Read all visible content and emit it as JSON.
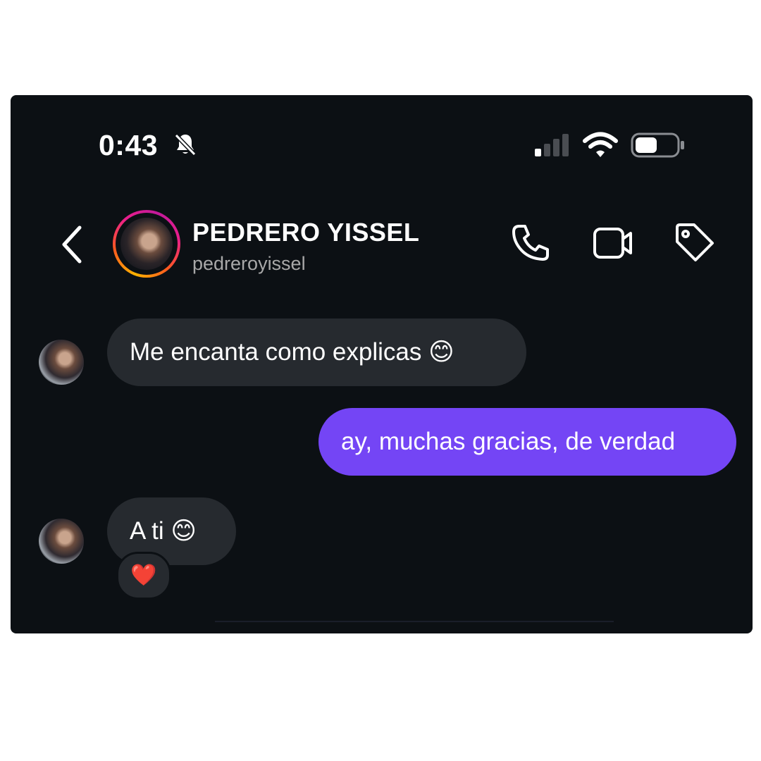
{
  "status_bar": {
    "time": "0:43",
    "mute_icon": "bell-slash-icon",
    "signal_icon": "cellular-signal-icon",
    "wifi_icon": "wifi-icon",
    "battery_icon": "battery-icon"
  },
  "header": {
    "back_icon": "chevron-left-icon",
    "name": "PEDRERO YISSEL",
    "username": "pedreroyissel",
    "actions": [
      "phone-icon",
      "video-camera-icon",
      "tag-icon"
    ]
  },
  "messages": [
    {
      "sender": "them",
      "text": "Me encanta como explicas 😊"
    },
    {
      "sender": "me",
      "text": "ay, muchas gracias, de verdad"
    },
    {
      "sender": "them",
      "text": "A ti 😊",
      "reaction": "❤️"
    }
  ],
  "colors": {
    "background": "#0c1014",
    "incoming_bubble": "#262a2f",
    "outgoing_bubble": "#7445f5"
  }
}
